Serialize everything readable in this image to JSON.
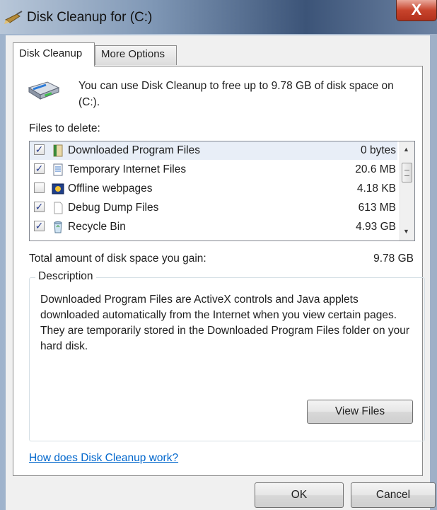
{
  "window": {
    "title": "Disk Cleanup for  (C:)",
    "close_label": "X"
  },
  "tabs": [
    {
      "label": "Disk Cleanup",
      "active": true
    },
    {
      "label": "More Options",
      "active": false
    }
  ],
  "intro_text": "You can use Disk Cleanup to free up to 9.78 GB of disk space on (C:).",
  "files_to_delete_label": "Files to delete:",
  "files": [
    {
      "name": "Downloaded Program Files",
      "size": "0 bytes",
      "checked": true,
      "icon": "folder-icon"
    },
    {
      "name": "Temporary Internet Files",
      "size": "20.6 MB",
      "checked": true,
      "icon": "document-icon"
    },
    {
      "name": "Offline webpages",
      "size": "4.18 KB",
      "checked": false,
      "icon": "offline-webpage-icon"
    },
    {
      "name": "Debug Dump Files",
      "size": "613 MB",
      "checked": true,
      "icon": "file-icon"
    },
    {
      "name": "Recycle Bin",
      "size": "4.93 GB",
      "checked": true,
      "icon": "recycle-bin-icon"
    }
  ],
  "total": {
    "label": "Total amount of disk space you gain:",
    "value": "9.78 GB"
  },
  "description": {
    "title": "Description",
    "text": "Downloaded Program Files are ActiveX controls and Java applets downloaded automatically from the Internet when you view certain pages. They are temporarily stored in the Downloaded Program Files folder on your hard disk.",
    "view_files_label": "View Files"
  },
  "help_link": "How does Disk Cleanup work?",
  "buttons": {
    "ok": "OK",
    "cancel": "Cancel"
  },
  "colors": {
    "link": "#0066cc",
    "close_button": "#c7442c",
    "selected_row": "#e8eef7"
  }
}
